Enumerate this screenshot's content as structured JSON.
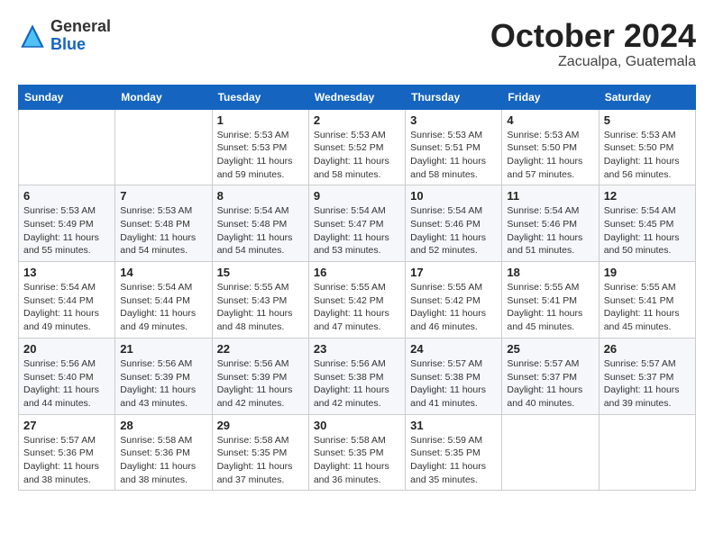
{
  "header": {
    "logo": {
      "general": "General",
      "blue": "Blue"
    },
    "title": "October 2024",
    "location": "Zacualpa, Guatemala"
  },
  "weekdays": [
    "Sunday",
    "Monday",
    "Tuesday",
    "Wednesday",
    "Thursday",
    "Friday",
    "Saturday"
  ],
  "weeks": [
    [
      {
        "day": "",
        "info": ""
      },
      {
        "day": "",
        "info": ""
      },
      {
        "day": "1",
        "info": "Sunrise: 5:53 AM\nSunset: 5:53 PM\nDaylight: 11 hours and 59 minutes."
      },
      {
        "day": "2",
        "info": "Sunrise: 5:53 AM\nSunset: 5:52 PM\nDaylight: 11 hours and 58 minutes."
      },
      {
        "day": "3",
        "info": "Sunrise: 5:53 AM\nSunset: 5:51 PM\nDaylight: 11 hours and 58 minutes."
      },
      {
        "day": "4",
        "info": "Sunrise: 5:53 AM\nSunset: 5:50 PM\nDaylight: 11 hours and 57 minutes."
      },
      {
        "day": "5",
        "info": "Sunrise: 5:53 AM\nSunset: 5:50 PM\nDaylight: 11 hours and 56 minutes."
      }
    ],
    [
      {
        "day": "6",
        "info": "Sunrise: 5:53 AM\nSunset: 5:49 PM\nDaylight: 11 hours and 55 minutes."
      },
      {
        "day": "7",
        "info": "Sunrise: 5:53 AM\nSunset: 5:48 PM\nDaylight: 11 hours and 54 minutes."
      },
      {
        "day": "8",
        "info": "Sunrise: 5:54 AM\nSunset: 5:48 PM\nDaylight: 11 hours and 54 minutes."
      },
      {
        "day": "9",
        "info": "Sunrise: 5:54 AM\nSunset: 5:47 PM\nDaylight: 11 hours and 53 minutes."
      },
      {
        "day": "10",
        "info": "Sunrise: 5:54 AM\nSunset: 5:46 PM\nDaylight: 11 hours and 52 minutes."
      },
      {
        "day": "11",
        "info": "Sunrise: 5:54 AM\nSunset: 5:46 PM\nDaylight: 11 hours and 51 minutes."
      },
      {
        "day": "12",
        "info": "Sunrise: 5:54 AM\nSunset: 5:45 PM\nDaylight: 11 hours and 50 minutes."
      }
    ],
    [
      {
        "day": "13",
        "info": "Sunrise: 5:54 AM\nSunset: 5:44 PM\nDaylight: 11 hours and 49 minutes."
      },
      {
        "day": "14",
        "info": "Sunrise: 5:54 AM\nSunset: 5:44 PM\nDaylight: 11 hours and 49 minutes."
      },
      {
        "day": "15",
        "info": "Sunrise: 5:55 AM\nSunset: 5:43 PM\nDaylight: 11 hours and 48 minutes."
      },
      {
        "day": "16",
        "info": "Sunrise: 5:55 AM\nSunset: 5:42 PM\nDaylight: 11 hours and 47 minutes."
      },
      {
        "day": "17",
        "info": "Sunrise: 5:55 AM\nSunset: 5:42 PM\nDaylight: 11 hours and 46 minutes."
      },
      {
        "day": "18",
        "info": "Sunrise: 5:55 AM\nSunset: 5:41 PM\nDaylight: 11 hours and 45 minutes."
      },
      {
        "day": "19",
        "info": "Sunrise: 5:55 AM\nSunset: 5:41 PM\nDaylight: 11 hours and 45 minutes."
      }
    ],
    [
      {
        "day": "20",
        "info": "Sunrise: 5:56 AM\nSunset: 5:40 PM\nDaylight: 11 hours and 44 minutes."
      },
      {
        "day": "21",
        "info": "Sunrise: 5:56 AM\nSunset: 5:39 PM\nDaylight: 11 hours and 43 minutes."
      },
      {
        "day": "22",
        "info": "Sunrise: 5:56 AM\nSunset: 5:39 PM\nDaylight: 11 hours and 42 minutes."
      },
      {
        "day": "23",
        "info": "Sunrise: 5:56 AM\nSunset: 5:38 PM\nDaylight: 11 hours and 42 minutes."
      },
      {
        "day": "24",
        "info": "Sunrise: 5:57 AM\nSunset: 5:38 PM\nDaylight: 11 hours and 41 minutes."
      },
      {
        "day": "25",
        "info": "Sunrise: 5:57 AM\nSunset: 5:37 PM\nDaylight: 11 hours and 40 minutes."
      },
      {
        "day": "26",
        "info": "Sunrise: 5:57 AM\nSunset: 5:37 PM\nDaylight: 11 hours and 39 minutes."
      }
    ],
    [
      {
        "day": "27",
        "info": "Sunrise: 5:57 AM\nSunset: 5:36 PM\nDaylight: 11 hours and 38 minutes."
      },
      {
        "day": "28",
        "info": "Sunrise: 5:58 AM\nSunset: 5:36 PM\nDaylight: 11 hours and 38 minutes."
      },
      {
        "day": "29",
        "info": "Sunrise: 5:58 AM\nSunset: 5:35 PM\nDaylight: 11 hours and 37 minutes."
      },
      {
        "day": "30",
        "info": "Sunrise: 5:58 AM\nSunset: 5:35 PM\nDaylight: 11 hours and 36 minutes."
      },
      {
        "day": "31",
        "info": "Sunrise: 5:59 AM\nSunset: 5:35 PM\nDaylight: 11 hours and 35 minutes."
      },
      {
        "day": "",
        "info": ""
      },
      {
        "day": "",
        "info": ""
      }
    ]
  ]
}
